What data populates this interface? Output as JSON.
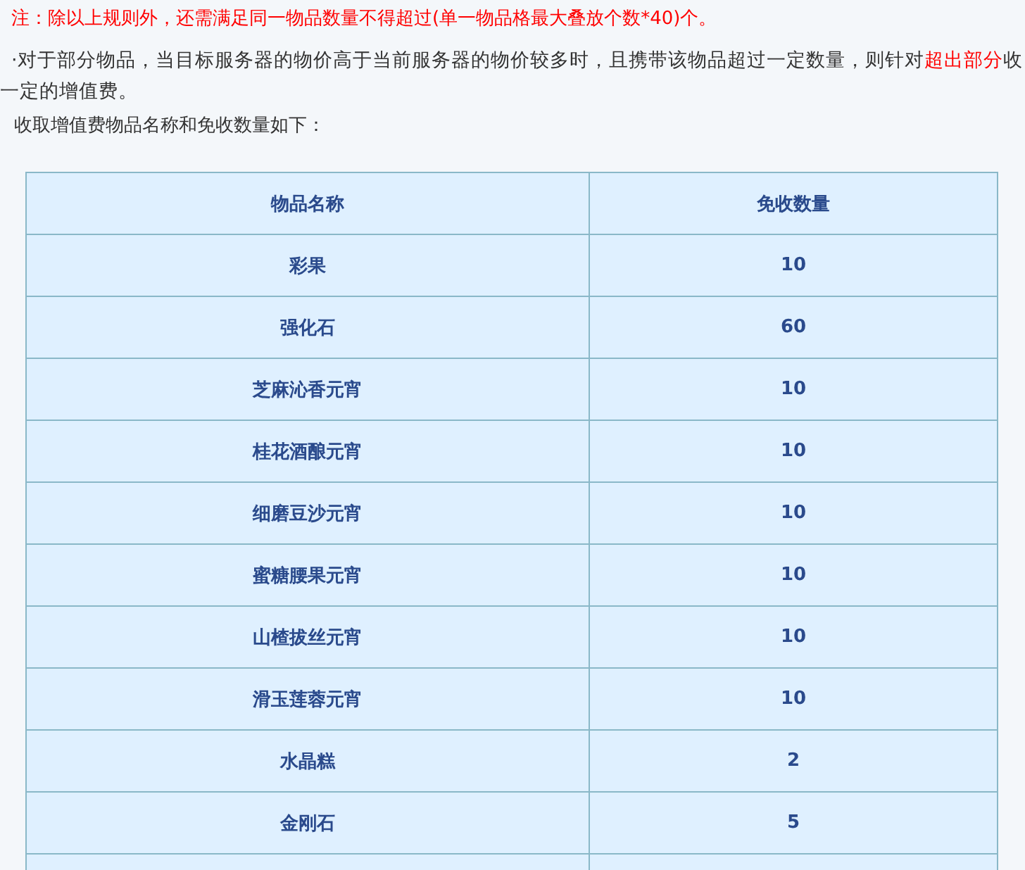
{
  "note": "注：除以上规则外，还需满足同一物品数量不得超过(单一物品格最大叠放个数*40)个。",
  "paragraph": "·对于部分物品，当目标服务器的物价高于当前服务器的物价较多时，且携带该物品超过一定数量，则针对**超出部分**收一定的增值费。",
  "intro": "收取增值费物品名称和免收数量如下：",
  "table": {
    "columns": [
      "物品名称",
      "免收数量"
    ],
    "rows": [
      [
        "彩果",
        "10"
      ],
      [
        "强化石",
        "60"
      ],
      [
        "芝麻沁香元宵",
        "10"
      ],
      [
        "桂花酒酿元宵",
        "10"
      ],
      [
        "细磨豆沙元宵",
        "10"
      ],
      [
        "蜜糖腰果元宵",
        "10"
      ],
      [
        "山楂拔丝元宵",
        "10"
      ],
      [
        "滑玉莲蓉元宵",
        "10"
      ],
      [
        "水晶糕",
        "2"
      ],
      [
        "金刚石",
        "5"
      ]
    ]
  }
}
